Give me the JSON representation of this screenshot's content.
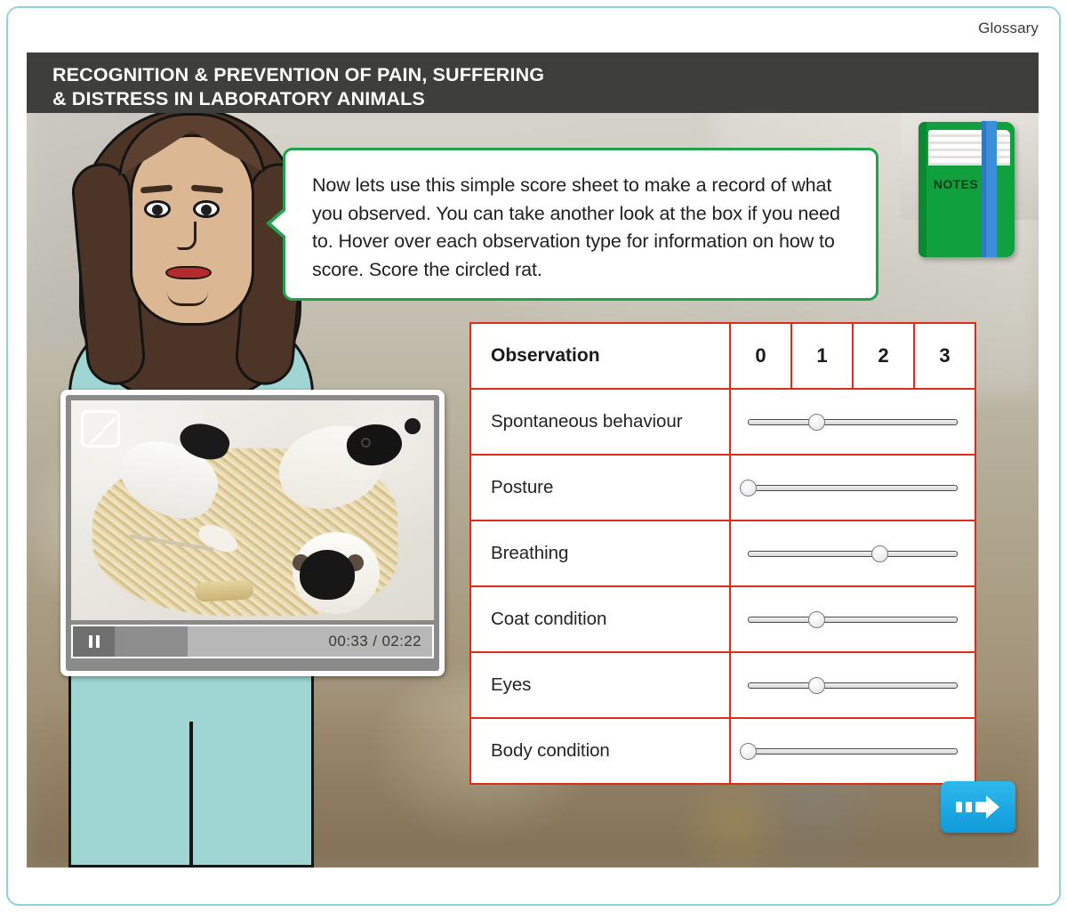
{
  "top_bar": {
    "glossary_label": "Glossary"
  },
  "header": {
    "title_line_1": "RECOGNITION & PREVENTION OF PAIN, SUFFERING",
    "title_line_2": "& DISTRESS IN LABORATORY ANIMALS"
  },
  "notes": {
    "label": "NOTES"
  },
  "speech_bubble": {
    "text": "Now lets use this simple score sheet to make a record of what you observed. You can take another look at the box if you need to. Hover over each observation type for information on how to score. Score the circled rat."
  },
  "video": {
    "current_time": "00:33",
    "total_time": "02:22",
    "time_display": "00:33 / 02:22",
    "progress_percent": 23,
    "state": "playing",
    "expand_icon": "expand-icon",
    "play_pause_icon": "pause-icon"
  },
  "score_sheet": {
    "observation_header": "Observation",
    "score_columns": [
      "0",
      "1",
      "2",
      "3"
    ],
    "rows": [
      {
        "label": "Spontaneous behaviour",
        "slider_percent": 33
      },
      {
        "label": "Posture",
        "slider_percent": 0
      },
      {
        "label": "Breathing",
        "slider_percent": 63
      },
      {
        "label": "Coat condition",
        "slider_percent": 33
      },
      {
        "label": "Eyes",
        "slider_percent": 33
      },
      {
        "label": "Body condition",
        "slider_percent": 0
      }
    ]
  },
  "navigation": {
    "next_icon": "next-arrow-icon"
  },
  "colors": {
    "frame_border": "#8ed3dd",
    "title_bar": "#3e3e3c",
    "table_border": "#e02b16",
    "bubble_border": "#22a24a",
    "next_button": "#0f9ada",
    "notes_cover": "#11a03e",
    "notes_bookmark": "#3d8fdc"
  }
}
